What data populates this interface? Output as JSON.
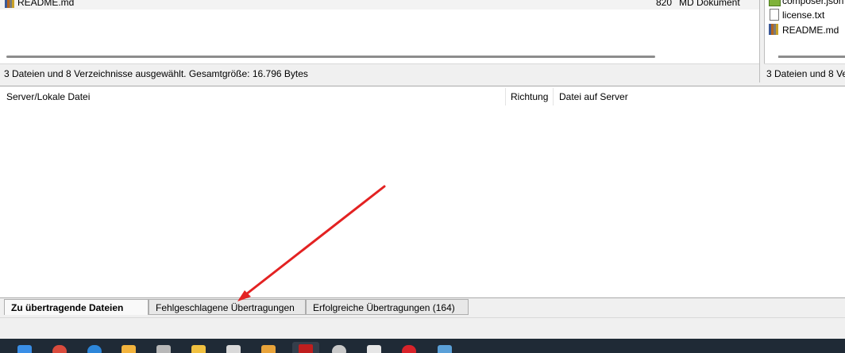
{
  "local": {
    "file_row": {
      "name": "README.md",
      "size": "820",
      "type": "MD Dokument"
    },
    "status": "3 Dateien und 8 Verzeichnisse ausgewählt. Gesamtgröße: 16.796 Bytes"
  },
  "remote": {
    "items": [
      "composer.json",
      "license.txt",
      "README.md"
    ],
    "status": "3 Dateien und 8 Ve"
  },
  "queue": {
    "columns": {
      "server_local": "Server/Lokale Datei",
      "direction": "Richtung",
      "remote_file": "Datei auf Server"
    }
  },
  "tabs": {
    "queued": "Zu übertragende Dateien",
    "failed": "Fehlgeschlagene Übertragungen",
    "successful": "Erfolgreiche Übertragungen (164)"
  },
  "annotation": {
    "color": "#e32222"
  },
  "taskbar_icons": [
    "windows-start-icon",
    "chrome-icon",
    "edge-icon",
    "folder-star-icon",
    "file-icon",
    "explorer-folder-icon",
    "calculator-icon",
    "paint-icon",
    "filezilla-icon",
    "clock-icon",
    "notepad-icon",
    "opera-icon",
    "calculator-app-icon"
  ]
}
